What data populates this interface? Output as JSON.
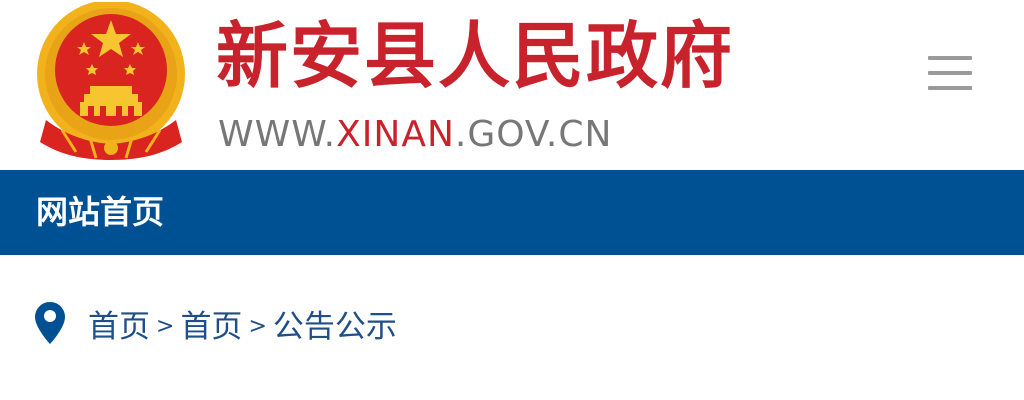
{
  "header": {
    "title": "新安县人民政府",
    "url_prefix": "WWW.",
    "url_accent": "XINAN",
    "url_suffix": ".GOV.CN",
    "emblem_icon": "national-emblem-icon",
    "menu_icon": "hamburger-menu-icon"
  },
  "nav": {
    "home_label": "网站首页"
  },
  "breadcrumb": {
    "icon": "location-pin-icon",
    "separator": ">",
    "items": [
      "首页",
      "首页",
      "公告公示"
    ]
  },
  "colors": {
    "brand_red": "#c8232c",
    "nav_blue": "#005194",
    "breadcrumb_blue": "#1f4f8a",
    "url_gray": "#777777",
    "menu_gray": "#9a9a9a",
    "emblem_gold": "#f2b21c"
  }
}
